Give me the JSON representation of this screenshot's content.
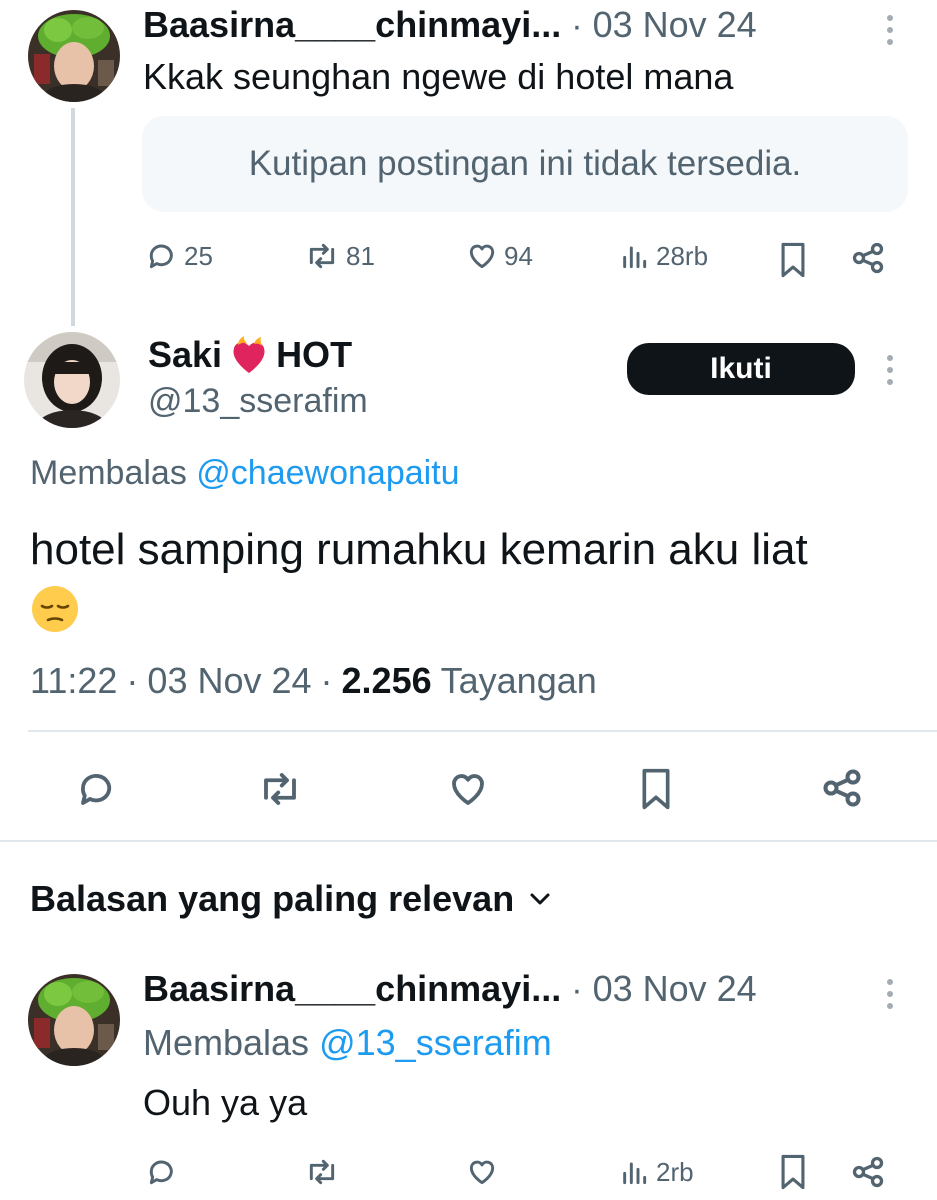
{
  "tweet1": {
    "name": "Baasirna____chinmayi...",
    "sep": "·",
    "date": "03 Nov 24",
    "text": "Kkak seunghan ngewe di hotel mana",
    "quote_unavailable": "Kutipan postingan ini tidak tersedia.",
    "actions": {
      "replies": "25",
      "reposts": "81",
      "likes": "94",
      "views": "28rb"
    }
  },
  "main_tweet": {
    "name": "Saki",
    "name_suffix": "HOT",
    "handle": "@13_sserafim",
    "follow_label": "Ikuti",
    "replying_to_prefix": "Membalas",
    "replying_to_handle": "@chaewonapaitu",
    "text": "hotel samping rumahku kemarin aku liat",
    "emoji": "😔",
    "time": "11:22",
    "sep": "·",
    "date": "03 Nov 24",
    "views_count": "2.256",
    "views_label": "Tayangan"
  },
  "sort": {
    "label": "Balasan yang paling relevan"
  },
  "reply1": {
    "name": "Baasirna____chinmayi...",
    "sep": "·",
    "date": "03 Nov 24",
    "replying_to_prefix": "Membalas",
    "replying_to_handle": "@13_sserafim",
    "text": "Ouh ya ya",
    "actions": {
      "views": "2rb"
    }
  },
  "colors": {
    "text": "#0f1419",
    "muted": "#536471",
    "link": "#1d9bf0",
    "button": "#0f1419"
  },
  "icons": [
    "reply-icon",
    "repost-icon",
    "like-icon",
    "views-icon",
    "bookmark-icon",
    "share-icon",
    "more-icon",
    "chevron-down-icon"
  ]
}
